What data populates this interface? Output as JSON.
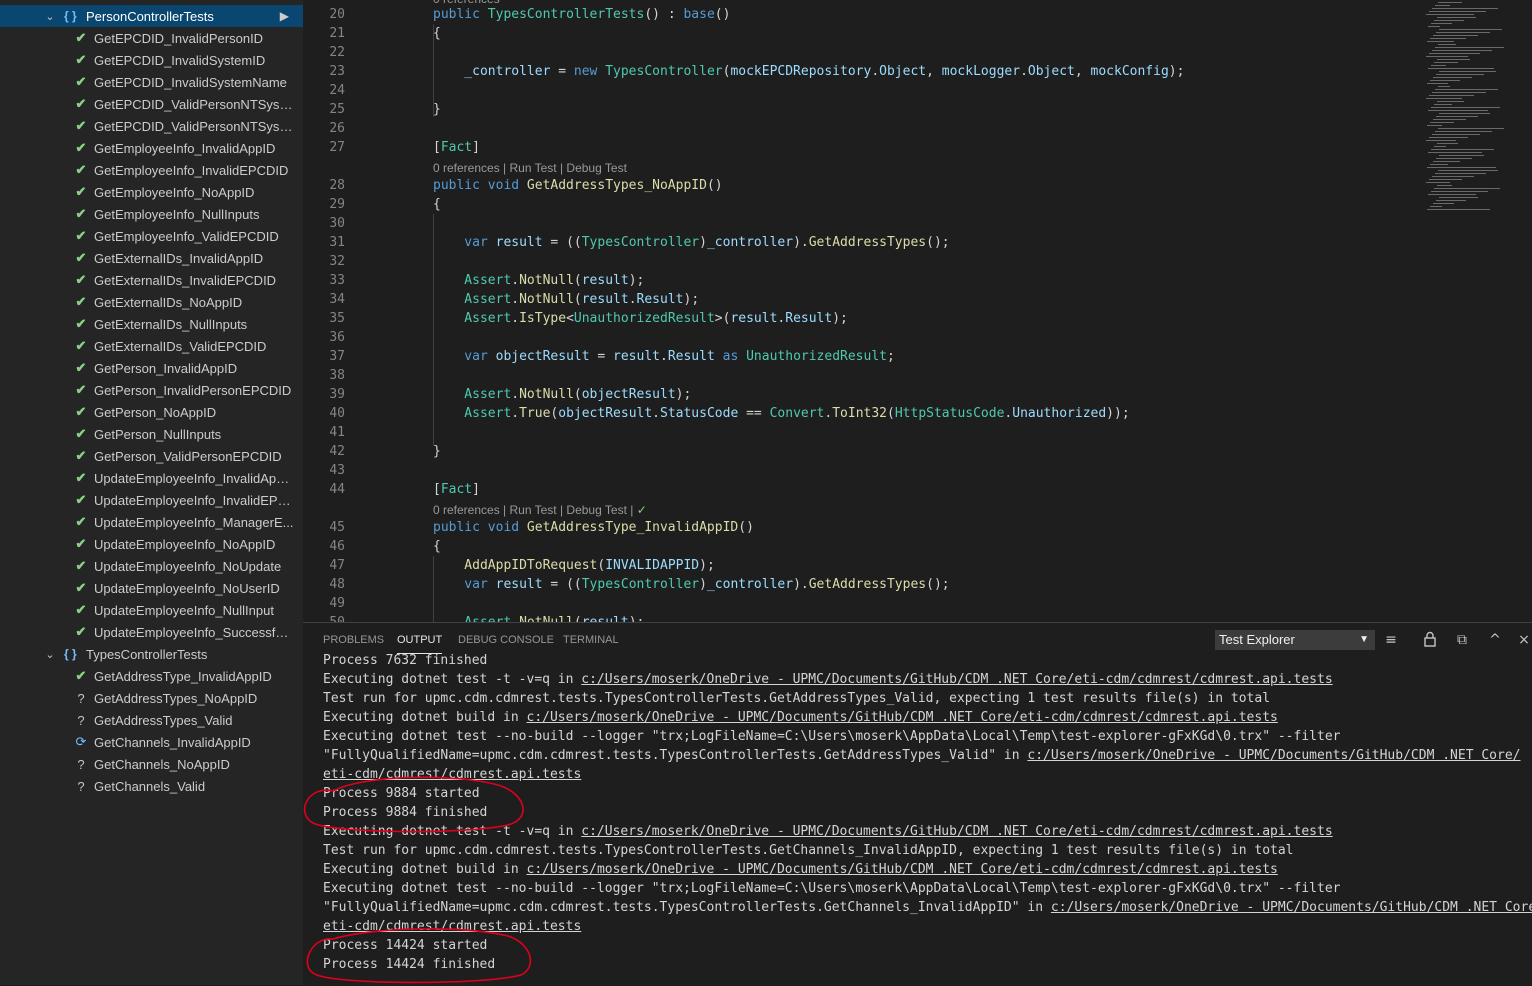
{
  "sidebar": {
    "person_group": {
      "label": "PersonControllerTests",
      "braces": "{ }"
    },
    "person_tests": [
      "GetEPCDID_InvalidPersonID",
      "GetEPCDID_InvalidSystemID",
      "GetEPCDID_InvalidSystemName",
      "GetEPCDID_ValidPersonNTSyste...",
      "GetEPCDID_ValidPersonNTSyste...",
      "GetEmployeeInfo_InvalidAppID",
      "GetEmployeeInfo_InvalidEPCDID",
      "GetEmployeeInfo_NoAppID",
      "GetEmployeeInfo_NullInputs",
      "GetEmployeeInfo_ValidEPCDID",
      "GetExternalIDs_InvalidAppID",
      "GetExternalIDs_InvalidEPCDID",
      "GetExternalIDs_NoAppID",
      "GetExternalIDs_NullInputs",
      "GetExternalIDs_ValidEPCDID",
      "GetPerson_InvalidAppID",
      "GetPerson_InvalidPersonEPCDID",
      "GetPerson_NoAppID",
      "GetPerson_NullInputs",
      "GetPerson_ValidPersonEPCDID",
      "UpdateEmployeeInfo_InvalidApp...",
      "UpdateEmployeeInfo_InvalidEPC...",
      "UpdateEmployeeInfo_ManagerE...",
      "UpdateEmployeeInfo_NoAppID",
      "UpdateEmployeeInfo_NoUpdate",
      "UpdateEmployeeInfo_NoUserID",
      "UpdateEmployeeInfo_NullInput",
      "UpdateEmployeeInfo_Successful..."
    ],
    "types_group": {
      "label": "TypesControllerTests",
      "braces": "{ }"
    },
    "types_tests": [
      {
        "label": "GetAddressType_InvalidAppID",
        "status": "pass"
      },
      {
        "label": "GetAddressTypes_NoAppID",
        "status": "unknown"
      },
      {
        "label": "GetAddressTypes_Valid",
        "status": "unknown"
      },
      {
        "label": "GetChannels_InvalidAppID",
        "status": "running"
      },
      {
        "label": "GetChannels_NoAppID",
        "status": "unknown"
      },
      {
        "label": "GetChannels_Valid",
        "status": "unknown"
      }
    ],
    "icons": {
      "pass": "✔",
      "unknown": "?",
      "running": "⟳",
      "run": "▶",
      "expanded": "⌄"
    }
  },
  "editor": {
    "top_partial": "0 references",
    "lens_1": "0 references | Run Test | Debug Test",
    "lens_2": "0 references | Run Test | Debug Test |",
    "lens_check": "✓",
    "lines": [
      {
        "n": "20",
        "t": [
          [
            "kw",
            "public "
          ],
          [
            "ty",
            "TypesControllerTests"
          ],
          [
            "pl",
            "() : "
          ],
          [
            "kw",
            "base"
          ],
          [
            "pl",
            "()"
          ]
        ]
      },
      {
        "n": "21",
        "t": [
          [
            "pl",
            "{"
          ]
        ]
      },
      {
        "n": "22",
        "t": []
      },
      {
        "n": "23",
        "t": [
          [
            "vr",
            "    _controller"
          ],
          [
            "pl",
            " = "
          ],
          [
            "kw",
            "new "
          ],
          [
            "ty",
            "TypesController"
          ],
          [
            "pl",
            "("
          ],
          [
            "vr",
            "mockEPCDRepository"
          ],
          [
            "pl",
            "."
          ],
          [
            "vr",
            "Object"
          ],
          [
            "pl",
            ", "
          ],
          [
            "vr",
            "mockLogger"
          ],
          [
            "pl",
            "."
          ],
          [
            "vr",
            "Object"
          ],
          [
            "pl",
            ", "
          ],
          [
            "vr",
            "mockConfig"
          ],
          [
            "pl",
            ");"
          ]
        ]
      },
      {
        "n": "24",
        "t": []
      },
      {
        "n": "25",
        "t": [
          [
            "pl",
            "}"
          ]
        ]
      },
      {
        "n": "26",
        "t": []
      },
      {
        "n": "27",
        "t": [
          [
            "pl",
            "["
          ],
          [
            "ty",
            "Fact"
          ],
          [
            "pl",
            "]"
          ]
        ]
      },
      {
        "n": "28",
        "t": [
          [
            "kw",
            "public void "
          ],
          [
            "fn",
            "GetAddressTypes_NoAppID"
          ],
          [
            "pl",
            "()"
          ]
        ]
      },
      {
        "n": "29",
        "t": [
          [
            "pl",
            "{"
          ]
        ]
      },
      {
        "n": "30",
        "t": []
      },
      {
        "n": "31",
        "t": [
          [
            "kw",
            "    var "
          ],
          [
            "vr",
            "result"
          ],
          [
            "pl",
            " = (("
          ],
          [
            "ty",
            "TypesController"
          ],
          [
            "pl",
            ")"
          ],
          [
            "vr",
            "_controller"
          ],
          [
            "pl",
            ")."
          ],
          [
            "fn",
            "GetAddressTypes"
          ],
          [
            "pl",
            "();"
          ]
        ]
      },
      {
        "n": "32",
        "t": []
      },
      {
        "n": "33",
        "t": [
          [
            "ty",
            "    Assert"
          ],
          [
            "pl",
            "."
          ],
          [
            "fn",
            "NotNull"
          ],
          [
            "pl",
            "("
          ],
          [
            "vr",
            "result"
          ],
          [
            "pl",
            ");"
          ]
        ]
      },
      {
        "n": "34",
        "t": [
          [
            "ty",
            "    Assert"
          ],
          [
            "pl",
            "."
          ],
          [
            "fn",
            "NotNull"
          ],
          [
            "pl",
            "("
          ],
          [
            "vr",
            "result"
          ],
          [
            "pl",
            "."
          ],
          [
            "vr",
            "Result"
          ],
          [
            "pl",
            ");"
          ]
        ]
      },
      {
        "n": "35",
        "t": [
          [
            "ty",
            "    Assert"
          ],
          [
            "pl",
            "."
          ],
          [
            "fn",
            "IsType"
          ],
          [
            "pl",
            "<"
          ],
          [
            "ty",
            "UnauthorizedResult"
          ],
          [
            "pl",
            ">("
          ],
          [
            "vr",
            "result"
          ],
          [
            "pl",
            "."
          ],
          [
            "vr",
            "Result"
          ],
          [
            "pl",
            ");"
          ]
        ]
      },
      {
        "n": "36",
        "t": []
      },
      {
        "n": "37",
        "t": [
          [
            "kw",
            "    var "
          ],
          [
            "vr",
            "objectResult"
          ],
          [
            "pl",
            " = "
          ],
          [
            "vr",
            "result"
          ],
          [
            "pl",
            "."
          ],
          [
            "vr",
            "Result"
          ],
          [
            "kw",
            " as "
          ],
          [
            "ty",
            "UnauthorizedResult"
          ],
          [
            "pl",
            ";"
          ]
        ]
      },
      {
        "n": "38",
        "t": []
      },
      {
        "n": "39",
        "t": [
          [
            "ty",
            "    Assert"
          ],
          [
            "pl",
            "."
          ],
          [
            "fn",
            "NotNull"
          ],
          [
            "pl",
            "("
          ],
          [
            "vr",
            "objectResult"
          ],
          [
            "pl",
            ");"
          ]
        ]
      },
      {
        "n": "40",
        "t": [
          [
            "ty",
            "    Assert"
          ],
          [
            "pl",
            "."
          ],
          [
            "fn",
            "True"
          ],
          [
            "pl",
            "("
          ],
          [
            "vr",
            "objectResult"
          ],
          [
            "pl",
            "."
          ],
          [
            "vr",
            "StatusCode"
          ],
          [
            "pl",
            " == "
          ],
          [
            "ty",
            "Convert"
          ],
          [
            "pl",
            "."
          ],
          [
            "fn",
            "ToInt32"
          ],
          [
            "pl",
            "("
          ],
          [
            "ty",
            "HttpStatusCode"
          ],
          [
            "pl",
            "."
          ],
          [
            "vr",
            "Unauthorized"
          ],
          [
            "pl",
            "));"
          ]
        ]
      },
      {
        "n": "41",
        "t": []
      },
      {
        "n": "42",
        "t": [
          [
            "pl",
            "}"
          ]
        ]
      },
      {
        "n": "43",
        "t": []
      },
      {
        "n": "44",
        "t": [
          [
            "pl",
            "["
          ],
          [
            "ty",
            "Fact"
          ],
          [
            "pl",
            "]"
          ]
        ]
      },
      {
        "n": "45",
        "t": [
          [
            "kw",
            "public void "
          ],
          [
            "fn",
            "GetAddressType_InvalidAppID"
          ],
          [
            "pl",
            "()"
          ]
        ]
      },
      {
        "n": "46",
        "t": [
          [
            "pl",
            "{"
          ]
        ]
      },
      {
        "n": "47",
        "t": [
          [
            "fn",
            "    AddAppIDToRequest"
          ],
          [
            "pl",
            "("
          ],
          [
            "vr",
            "INVALIDAPPID"
          ],
          [
            "pl",
            ");"
          ]
        ]
      },
      {
        "n": "48",
        "t": [
          [
            "kw",
            "    var "
          ],
          [
            "vr",
            "result"
          ],
          [
            "pl",
            " = (("
          ],
          [
            "ty",
            "TypesController"
          ],
          [
            "pl",
            ")"
          ],
          [
            "vr",
            "_controller"
          ],
          [
            "pl",
            ")."
          ],
          [
            "fn",
            "GetAddressTypes"
          ],
          [
            "pl",
            "();"
          ]
        ]
      },
      {
        "n": "49",
        "t": []
      },
      {
        "n": "50",
        "t": [
          [
            "ty",
            "    Assert"
          ],
          [
            "pl",
            "."
          ],
          [
            "fn",
            "NotNull"
          ],
          [
            "pl",
            "("
          ],
          [
            "vr",
            "result"
          ],
          [
            "pl",
            ");"
          ]
        ]
      }
    ]
  },
  "panel": {
    "tabs": [
      "PROBLEMS",
      "OUTPUT",
      "DEBUG CONSOLE",
      "TERMINAL"
    ],
    "active_tab": "OUTPUT",
    "channel": "Test Explorer",
    "icons": {
      "clear": "≡",
      "lock": "🔒",
      "copy": "⧉",
      "maximize": "^",
      "close": "×"
    },
    "lines": [
      [
        [
          "t",
          "Process 7632 finished"
        ]
      ],
      [
        [
          "t",
          "Executing dotnet test -t -v=q in "
        ],
        [
          "u",
          "c:/Users/moserk/OneDrive - UPMC/Documents/GitHub/CDM .NET Core/eti-cdm/cdmrest/cdmrest.api.tests"
        ]
      ],
      [
        [
          "t",
          "Test run for upmc.cdm.cdmrest.tests.TypesControllerTests.GetAddressTypes_Valid, expecting 1 test results file(s) in total"
        ]
      ],
      [
        [
          "t",
          "Executing dotnet build in "
        ],
        [
          "u",
          "c:/Users/moserk/OneDrive - UPMC/Documents/GitHub/CDM .NET Core/eti-cdm/cdmrest/cdmrest.api.tests"
        ]
      ],
      [
        [
          "t",
          "Executing dotnet test --no-build --logger \"trx;LogFileName=C:\\Users\\moserk\\AppData\\Local\\Temp\\test-explorer-gFxKGd\\0.trx\" --filter"
        ]
      ],
      [
        [
          "t",
          "\"FullyQualifiedName=upmc.cdm.cdmrest.tests.TypesControllerTests.GetAddressTypes_Valid\" in "
        ],
        [
          "u",
          "c:/Users/moserk/OneDrive - UPMC/Documents/GitHub/CDM .NET Core/"
        ]
      ],
      [
        [
          "u",
          "eti-cdm/cdmrest/cdmrest.api.tests"
        ]
      ],
      [
        [
          "t",
          "Process 9884 started"
        ]
      ],
      [
        [
          "t",
          "Process 9884 finished"
        ]
      ],
      [
        [
          "t",
          "Executing dotnet test -t -v=q in "
        ],
        [
          "u",
          "c:/Users/moserk/OneDrive - UPMC/Documents/GitHub/CDM .NET Core/eti-cdm/cdmrest/cdmrest.api.tests"
        ]
      ],
      [
        [
          "t",
          "Test run for upmc.cdm.cdmrest.tests.TypesControllerTests.GetChannels_InvalidAppID, expecting 1 test results file(s) in total"
        ]
      ],
      [
        [
          "t",
          "Executing dotnet build in "
        ],
        [
          "u",
          "c:/Users/moserk/OneDrive - UPMC/Documents/GitHub/CDM .NET Core/eti-cdm/cdmrest/cdmrest.api.tests"
        ]
      ],
      [
        [
          "t",
          "Executing dotnet test --no-build --logger \"trx;LogFileName=C:\\Users\\moserk\\AppData\\Local\\Temp\\test-explorer-gFxKGd\\0.trx\" --filter"
        ]
      ],
      [
        [
          "t",
          "\"FullyQualifiedName=upmc.cdm.cdmrest.tests.TypesControllerTests.GetChannels_InvalidAppID\" in "
        ],
        [
          "u",
          "c:/Users/moserk/OneDrive - UPMC/Documents/GitHub/CDM .NET Core/"
        ]
      ],
      [
        [
          "u",
          "eti-cdm/cdmrest/cdmrest.api.tests"
        ]
      ],
      [
        [
          "t",
          "Process 14424 started"
        ]
      ],
      [
        [
          "t",
          "Process 14424 finished"
        ]
      ]
    ]
  },
  "theme": {
    "accent": "#094771",
    "pass": "#89d185",
    "annotation": "#e0001b"
  }
}
